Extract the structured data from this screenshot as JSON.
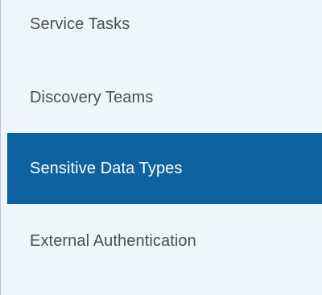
{
  "sidebar": {
    "items": [
      {
        "label": "Service Tasks",
        "active": false
      },
      {
        "label": "Discovery Teams",
        "active": false
      },
      {
        "label": "Sensitive Data Types",
        "active": true
      },
      {
        "label": "External Authentication",
        "active": false
      }
    ],
    "colors": {
      "background": "#eef5fc",
      "active_background": "#0f62a0",
      "active_text": "#ffffff",
      "text": "#4b4f55",
      "border": "#b9c3cc"
    }
  }
}
